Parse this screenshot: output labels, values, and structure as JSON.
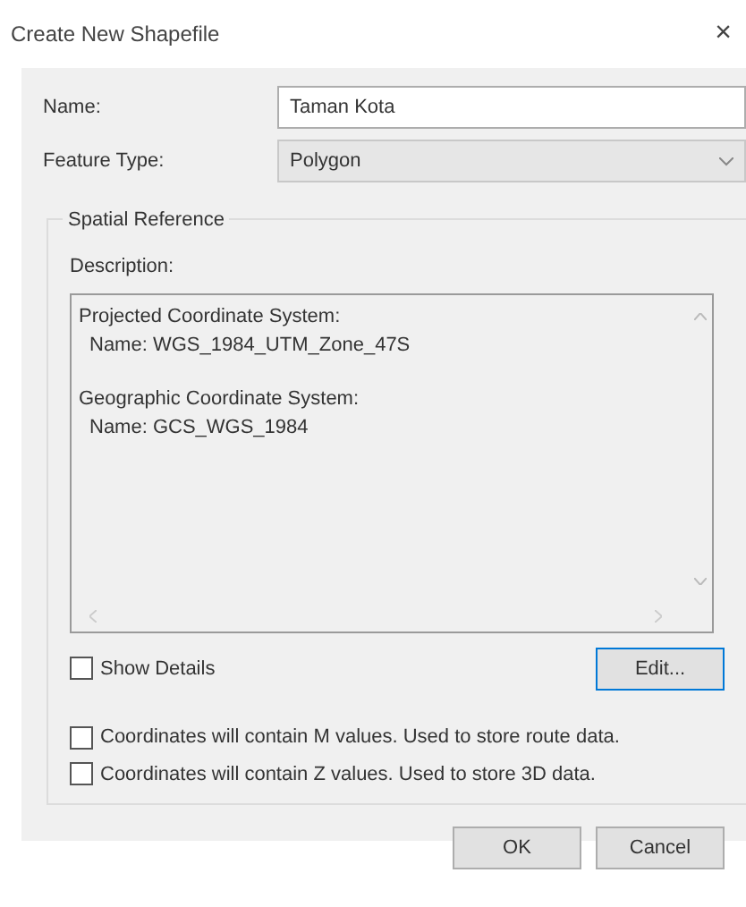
{
  "window": {
    "title": "Create New Shapefile",
    "close": "×"
  },
  "name_field": {
    "label": "Name:",
    "value": "Taman Kota"
  },
  "feature_type": {
    "label": "Feature Type:",
    "value": "Polygon",
    "disabled": true
  },
  "spatial_reference": {
    "title": "Spatial Reference",
    "description_label": "Description:",
    "description_blocks": [
      {
        "heading": "Projected Coordinate System:",
        "detail": "Name: WGS_1984_UTM_Zone_47S"
      },
      {
        "heading": "Geographic Coordinate System:",
        "detail": "Name: GCS_WGS_1984"
      }
    ],
    "show_details": {
      "label": "Show Details",
      "checked": false
    },
    "edit_button": "Edit..."
  },
  "options": [
    {
      "label": "Coordinates will contain M values. Used to store route data.",
      "checked": false
    },
    {
      "label": "Coordinates will contain Z values. Used to store 3D data.",
      "checked": false
    }
  ],
  "buttons": [
    {
      "label": "OK",
      "focused": false
    },
    {
      "label": "Cancel",
      "focused": false
    }
  ]
}
